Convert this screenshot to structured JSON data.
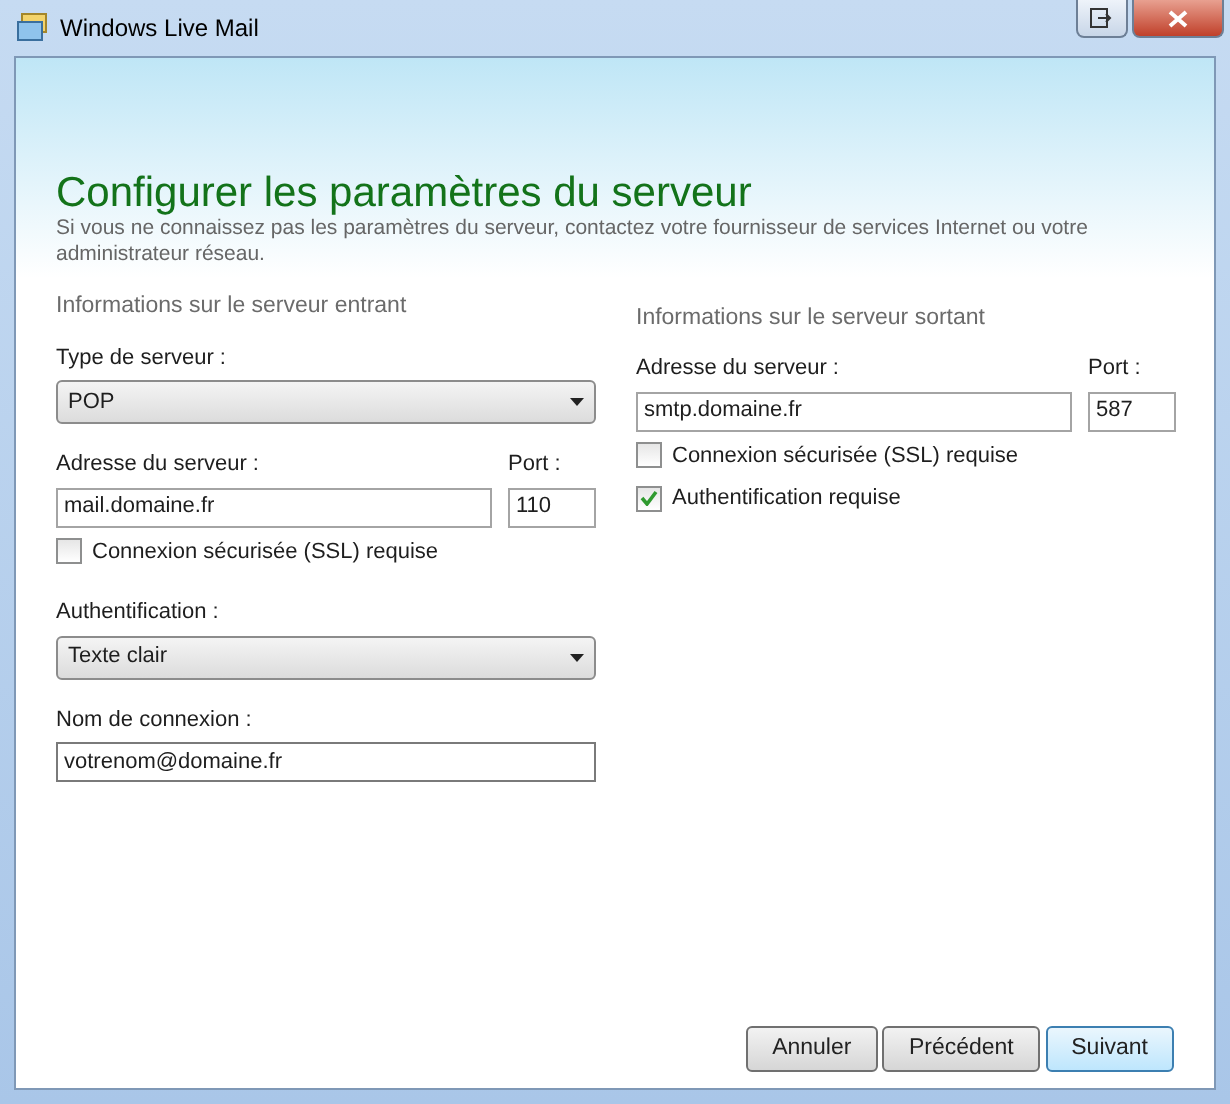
{
  "window": {
    "title": "Windows Live Mail"
  },
  "heading": "Configurer les paramètres du serveur",
  "intro": "Si vous ne connaissez pas les paramètres du serveur, contactez votre fournisseur de services Internet ou votre administrateur réseau.",
  "incoming": {
    "heading": "Informations sur le serveur entrant",
    "items": [
      {
        "kind": "select",
        "label": "Type de serveur :",
        "value": "POP"
      },
      {
        "kind": "address",
        "label": "Adresse du serveur :",
        "value": "mail.domaine.fr",
        "port_label": "Port :",
        "port": "110"
      },
      {
        "kind": "checkbox",
        "label": "Connexion sécurisée (SSL) requise",
        "checked": false
      },
      {
        "kind": "select",
        "label": "Authentification :",
        "value": "Texte clair"
      },
      {
        "kind": "text",
        "label": "Nom de connexion :",
        "value": "votrenom@domaine.fr"
      }
    ]
  },
  "outgoing": {
    "heading": "Informations sur le serveur sortant",
    "items": [
      {
        "kind": "address",
        "label": "Adresse du serveur :",
        "value": "smtp.domaine.fr",
        "port_label": "Port :",
        "port": "587"
      },
      {
        "kind": "checkbox",
        "label": "Connexion sécurisée (SSL) requise",
        "checked": false
      },
      {
        "kind": "checkbox",
        "label": "Authentification requise",
        "checked": true
      }
    ]
  },
  "buttons": [
    {
      "label": "Annuler",
      "default": false
    },
    {
      "label": "Précédent",
      "default": false
    },
    {
      "label": "Suivant",
      "default": true
    }
  ]
}
